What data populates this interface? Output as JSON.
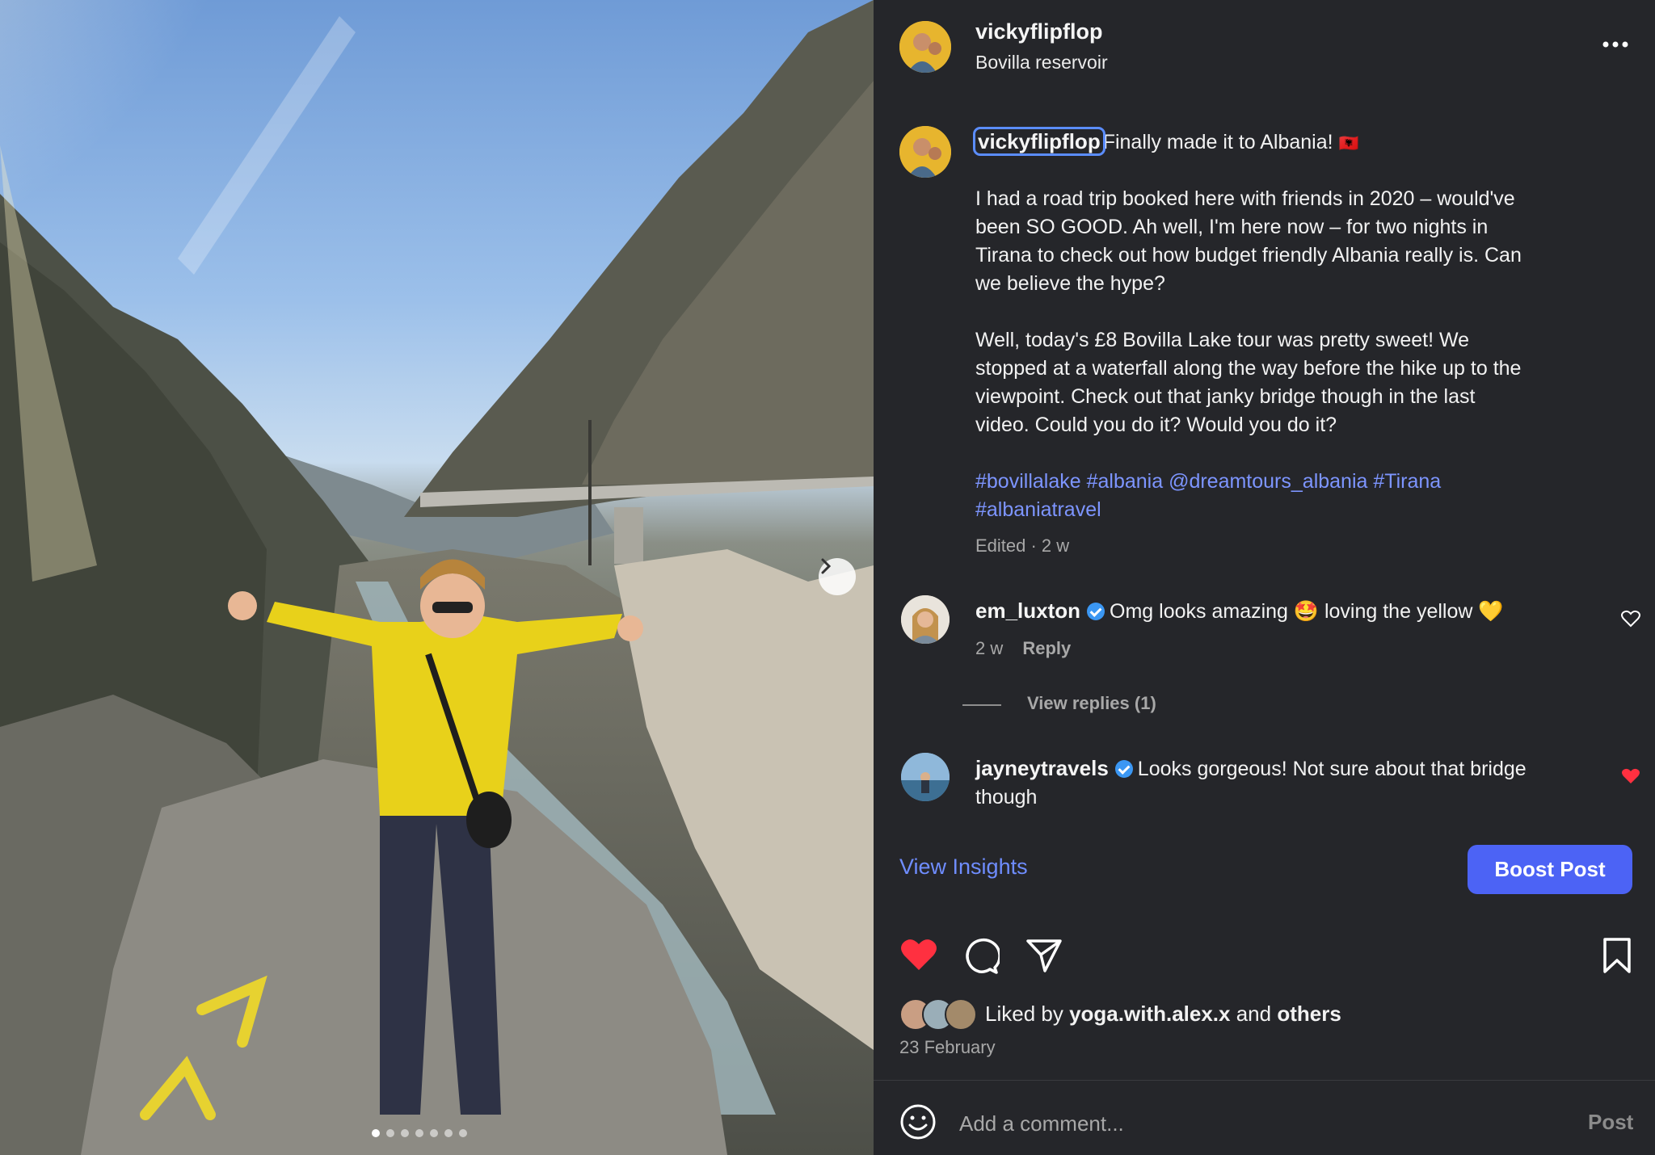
{
  "post": {
    "username": "vickyflipflop",
    "location": "Bovilla reservoir",
    "caption_username": "vickyflipflop",
    "caption_first_line": "Finally made it to Albania! ",
    "flag_emoji": "🇦🇱",
    "paragraph1_lines": [
      "I had a road trip booked here with friends in 2020 – would've",
      "been SO GOOD. Ah well, I'm here now – for two nights in",
      "Tirana to check out how budget friendly Albania really is. Can",
      "we believe the hype?"
    ],
    "paragraph2_lines": [
      "Well, today's £8 Bovilla Lake tour was pretty sweet! We",
      "stopped at a waterfall along the way before the hike up to the",
      "viewpoint. Check out that janky bridge though in the last",
      "video. Could you do it? Would you do it?"
    ],
    "tags_line1": "#bovillalake #albania @dreamtours_albania #Tirana",
    "tags_line2": "#albaniatravel",
    "edited": "Edited · 2 w"
  },
  "comments": [
    {
      "username": "em_luxton",
      "text": "Omg looks amazing 🤩 loving the yellow 💛",
      "time": "2 w",
      "reply": "Reply",
      "view_replies": "View replies (1)",
      "liked": false
    },
    {
      "username": "jayneytravels",
      "text_line1": "Looks gorgeous! Not sure about that bridge",
      "text_line2": "though",
      "liked": true
    }
  ],
  "actions": {
    "view_insights": "View Insights",
    "boost_post": "Boost Post",
    "liked_by_prefix": "Liked by ",
    "liked_by_user": "yoga.with.alex.x",
    "liked_by_and": " and ",
    "liked_by_others": "others",
    "date": "23 February",
    "comment_placeholder": "Add a comment...",
    "post_button": "Post"
  },
  "carousel": {
    "slide_count": 7,
    "active_index": 0
  },
  "colors": {
    "panel_bg": "#25262a",
    "accent": "#4c63f5",
    "link": "#7d95ff",
    "like_red": "#ff3040"
  },
  "icons": [
    "more-icon",
    "heart-icon",
    "comment-icon",
    "share-icon",
    "bookmark-icon",
    "emoji-icon",
    "chevron-right-icon",
    "verified-icon"
  ]
}
